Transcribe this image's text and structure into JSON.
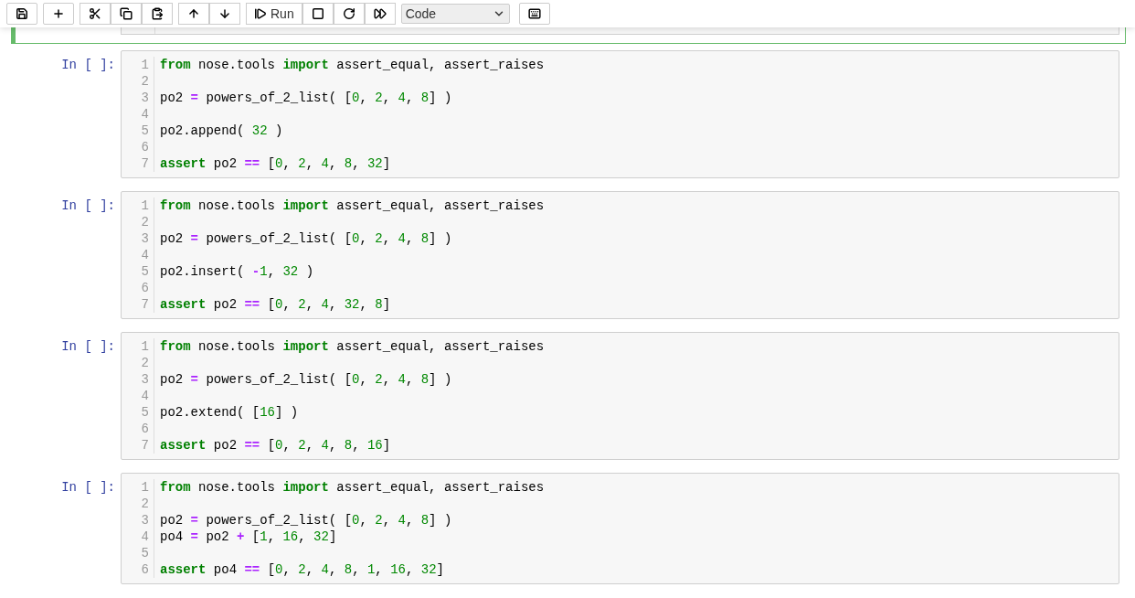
{
  "toolbar": {
    "run_label": "Run",
    "cell_type": "Code"
  },
  "cells": [
    {
      "prompt": "In [ ]:",
      "lines": [
        {
          "n": "1",
          "tokens": [
            {
              "kind": "keyword",
              "t": "from"
            },
            {
              "kind": "plain",
              "t": " nose.tools "
            },
            {
              "kind": "keyword",
              "t": "import"
            },
            {
              "kind": "plain",
              "t": " assert_equal, assert_raises"
            }
          ]
        },
        {
          "n": "2"
        },
        {
          "n": "3",
          "tokens": [
            {
              "kind": "plain",
              "t": "po2 "
            },
            {
              "kind": "operator",
              "t": "="
            },
            {
              "kind": "plain",
              "t": " powers_of_2_list( ["
            },
            {
              "kind": "number",
              "t": "0"
            },
            {
              "kind": "plain",
              "t": ", "
            },
            {
              "kind": "number",
              "t": "2"
            },
            {
              "kind": "plain",
              "t": ", "
            },
            {
              "kind": "number",
              "t": "4"
            },
            {
              "kind": "plain",
              "t": ", "
            },
            {
              "kind": "number",
              "t": "8"
            },
            {
              "kind": "plain",
              "t": "] )"
            }
          ]
        },
        {
          "n": "4"
        },
        {
          "n": "5",
          "tokens": [
            {
              "kind": "plain",
              "t": "po2.append( "
            },
            {
              "kind": "number",
              "t": "32"
            },
            {
              "kind": "plain",
              "t": " )"
            }
          ]
        },
        {
          "n": "6"
        },
        {
          "n": "7",
          "tokens": [
            {
              "kind": "keyword",
              "t": "assert"
            },
            {
              "kind": "plain",
              "t": " po2 "
            },
            {
              "kind": "operator",
              "t": "=="
            },
            {
              "kind": "plain",
              "t": " ["
            },
            {
              "kind": "number",
              "t": "0"
            },
            {
              "kind": "plain",
              "t": ", "
            },
            {
              "kind": "number",
              "t": "2"
            },
            {
              "kind": "plain",
              "t": ", "
            },
            {
              "kind": "number",
              "t": "4"
            },
            {
              "kind": "plain",
              "t": ", "
            },
            {
              "kind": "number",
              "t": "8"
            },
            {
              "kind": "plain",
              "t": ", "
            },
            {
              "kind": "number",
              "t": "32"
            },
            {
              "kind": "plain",
              "t": "]"
            }
          ]
        }
      ]
    },
    {
      "prompt": "In [ ]:",
      "lines": [
        {
          "n": "1",
          "tokens": [
            {
              "kind": "keyword",
              "t": "from"
            },
            {
              "kind": "plain",
              "t": " nose.tools "
            },
            {
              "kind": "keyword",
              "t": "import"
            },
            {
              "kind": "plain",
              "t": " assert_equal, assert_raises"
            }
          ]
        },
        {
          "n": "2"
        },
        {
          "n": "3",
          "tokens": [
            {
              "kind": "plain",
              "t": "po2 "
            },
            {
              "kind": "operator",
              "t": "="
            },
            {
              "kind": "plain",
              "t": " powers_of_2_list( ["
            },
            {
              "kind": "number",
              "t": "0"
            },
            {
              "kind": "plain",
              "t": ", "
            },
            {
              "kind": "number",
              "t": "2"
            },
            {
              "kind": "plain",
              "t": ", "
            },
            {
              "kind": "number",
              "t": "4"
            },
            {
              "kind": "plain",
              "t": ", "
            },
            {
              "kind": "number",
              "t": "8"
            },
            {
              "kind": "plain",
              "t": "] )"
            }
          ]
        },
        {
          "n": "4"
        },
        {
          "n": "5",
          "tokens": [
            {
              "kind": "plain",
              "t": "po2.insert( "
            },
            {
              "kind": "operator",
              "t": "-"
            },
            {
              "kind": "number",
              "t": "1"
            },
            {
              "kind": "plain",
              "t": ", "
            },
            {
              "kind": "number",
              "t": "32"
            },
            {
              "kind": "plain",
              "t": " )"
            }
          ]
        },
        {
          "n": "6"
        },
        {
          "n": "7",
          "tokens": [
            {
              "kind": "keyword",
              "t": "assert"
            },
            {
              "kind": "plain",
              "t": " po2 "
            },
            {
              "kind": "operator",
              "t": "=="
            },
            {
              "kind": "plain",
              "t": " ["
            },
            {
              "kind": "number",
              "t": "0"
            },
            {
              "kind": "plain",
              "t": ", "
            },
            {
              "kind": "number",
              "t": "2"
            },
            {
              "kind": "plain",
              "t": ", "
            },
            {
              "kind": "number",
              "t": "4"
            },
            {
              "kind": "plain",
              "t": ", "
            },
            {
              "kind": "number",
              "t": "32"
            },
            {
              "kind": "plain",
              "t": ", "
            },
            {
              "kind": "number",
              "t": "8"
            },
            {
              "kind": "plain",
              "t": "]"
            }
          ]
        }
      ]
    },
    {
      "prompt": "In [ ]:",
      "lines": [
        {
          "n": "1",
          "tokens": [
            {
              "kind": "keyword",
              "t": "from"
            },
            {
              "kind": "plain",
              "t": " nose.tools "
            },
            {
              "kind": "keyword",
              "t": "import"
            },
            {
              "kind": "plain",
              "t": " assert_equal, assert_raises"
            }
          ]
        },
        {
          "n": "2"
        },
        {
          "n": "3",
          "tokens": [
            {
              "kind": "plain",
              "t": "po2 "
            },
            {
              "kind": "operator",
              "t": "="
            },
            {
              "kind": "plain",
              "t": " powers_of_2_list( ["
            },
            {
              "kind": "number",
              "t": "0"
            },
            {
              "kind": "plain",
              "t": ", "
            },
            {
              "kind": "number",
              "t": "2"
            },
            {
              "kind": "plain",
              "t": ", "
            },
            {
              "kind": "number",
              "t": "4"
            },
            {
              "kind": "plain",
              "t": ", "
            },
            {
              "kind": "number",
              "t": "8"
            },
            {
              "kind": "plain",
              "t": "] )"
            }
          ]
        },
        {
          "n": "4"
        },
        {
          "n": "5",
          "tokens": [
            {
              "kind": "plain",
              "t": "po2.extend( ["
            },
            {
              "kind": "number",
              "t": "16"
            },
            {
              "kind": "plain",
              "t": "] )"
            }
          ]
        },
        {
          "n": "6"
        },
        {
          "n": "7",
          "tokens": [
            {
              "kind": "keyword",
              "t": "assert"
            },
            {
              "kind": "plain",
              "t": " po2 "
            },
            {
              "kind": "operator",
              "t": "=="
            },
            {
              "kind": "plain",
              "t": " ["
            },
            {
              "kind": "number",
              "t": "0"
            },
            {
              "kind": "plain",
              "t": ", "
            },
            {
              "kind": "number",
              "t": "2"
            },
            {
              "kind": "plain",
              "t": ", "
            },
            {
              "kind": "number",
              "t": "4"
            },
            {
              "kind": "plain",
              "t": ", "
            },
            {
              "kind": "number",
              "t": "8"
            },
            {
              "kind": "plain",
              "t": ", "
            },
            {
              "kind": "number",
              "t": "16"
            },
            {
              "kind": "plain",
              "t": "]"
            }
          ]
        }
      ]
    },
    {
      "prompt": "In [ ]:",
      "lines": [
        {
          "n": "1",
          "tokens": [
            {
              "kind": "keyword",
              "t": "from"
            },
            {
              "kind": "plain",
              "t": " nose.tools "
            },
            {
              "kind": "keyword",
              "t": "import"
            },
            {
              "kind": "plain",
              "t": " assert_equal, assert_raises"
            }
          ]
        },
        {
          "n": "2"
        },
        {
          "n": "3",
          "tokens": [
            {
              "kind": "plain",
              "t": "po2 "
            },
            {
              "kind": "operator",
              "t": "="
            },
            {
              "kind": "plain",
              "t": " powers_of_2_list( ["
            },
            {
              "kind": "number",
              "t": "0"
            },
            {
              "kind": "plain",
              "t": ", "
            },
            {
              "kind": "number",
              "t": "2"
            },
            {
              "kind": "plain",
              "t": ", "
            },
            {
              "kind": "number",
              "t": "4"
            },
            {
              "kind": "plain",
              "t": ", "
            },
            {
              "kind": "number",
              "t": "8"
            },
            {
              "kind": "plain",
              "t": "] )"
            }
          ]
        },
        {
          "n": "4",
          "tokens": [
            {
              "kind": "plain",
              "t": "po4 "
            },
            {
              "kind": "operator",
              "t": "="
            },
            {
              "kind": "plain",
              "t": " po2 "
            },
            {
              "kind": "operator",
              "t": "+"
            },
            {
              "kind": "plain",
              "t": " ["
            },
            {
              "kind": "number",
              "t": "1"
            },
            {
              "kind": "plain",
              "t": ", "
            },
            {
              "kind": "number",
              "t": "16"
            },
            {
              "kind": "plain",
              "t": ", "
            },
            {
              "kind": "number",
              "t": "32"
            },
            {
              "kind": "plain",
              "t": "]"
            }
          ]
        },
        {
          "n": "5"
        },
        {
          "n": "6",
          "tokens": [
            {
              "kind": "keyword",
              "t": "assert"
            },
            {
              "kind": "plain",
              "t": " po4 "
            },
            {
              "kind": "operator",
              "t": "=="
            },
            {
              "kind": "plain",
              "t": " ["
            },
            {
              "kind": "number",
              "t": "0"
            },
            {
              "kind": "plain",
              "t": ", "
            },
            {
              "kind": "number",
              "t": "2"
            },
            {
              "kind": "plain",
              "t": ", "
            },
            {
              "kind": "number",
              "t": "4"
            },
            {
              "kind": "plain",
              "t": ", "
            },
            {
              "kind": "number",
              "t": "8"
            },
            {
              "kind": "plain",
              "t": ", "
            },
            {
              "kind": "number",
              "t": "1"
            },
            {
              "kind": "plain",
              "t": ", "
            },
            {
              "kind": "number",
              "t": "16"
            },
            {
              "kind": "plain",
              "t": ", "
            },
            {
              "kind": "number",
              "t": "32"
            },
            {
              "kind": "plain",
              "t": "]"
            }
          ]
        }
      ]
    }
  ]
}
